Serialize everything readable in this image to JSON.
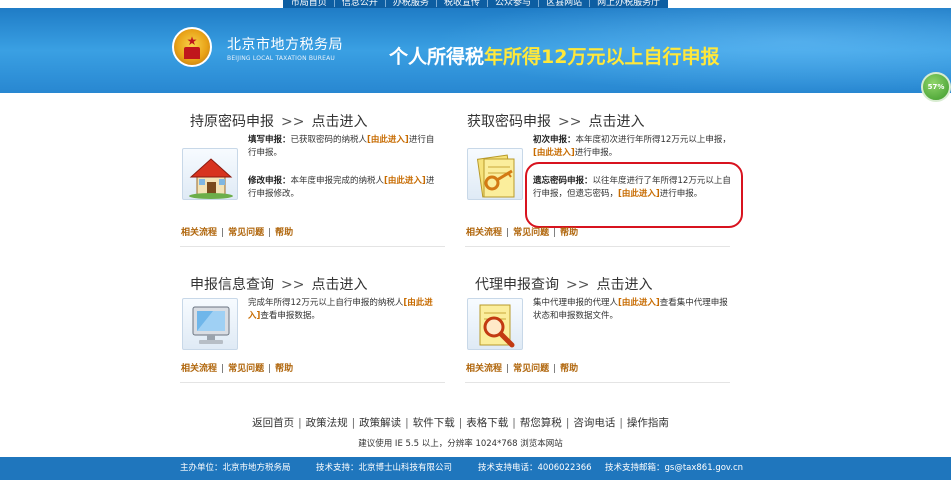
{
  "top_nav": [
    "市局首页",
    "信息公开",
    "办税服务",
    "税收宣传",
    "公众参与",
    "区县网站",
    "网上办税服务厅"
  ],
  "header": {
    "org_cn": "北京市地方税务局",
    "org_en": "BEIJING LOCAL TAXATION BUREAU",
    "title_prefix": "个人所得税",
    "title_highlight": "年所得12万元以上自行申报"
  },
  "progress_badge": "57%",
  "sections": {
    "original_password": {
      "title": "持原密码申报",
      "arrows": ">>",
      "enter": "点击进入",
      "fill_label": "填写申报：",
      "fill_text_1": "已获取密码的纳税人",
      "fill_link": "[由此进入]",
      "fill_text_2": "进行自行申报。",
      "modify_label": "修改申报：",
      "modify_text_1": "本年度申报完成的纳税人",
      "modify_link": "[由此进入]",
      "modify_text_2": "进行申报修改。",
      "links": [
        "相关流程",
        "常见问题",
        "帮助"
      ]
    },
    "get_password": {
      "title": "获取密码申报",
      "arrows": ">>",
      "enter": "点击进入",
      "first_label": "初次申报：",
      "first_text_1": "本年度初次进行年所得12万元以上申报，",
      "first_link": "[由此进入]",
      "first_text_2": "进行申报。",
      "forgot_label": "遗忘密码申报：",
      "forgot_text_1": "以往年度进行了年所得12万元以上自行申报，但遗忘密码，",
      "forgot_link": "[由此进入]",
      "forgot_text_2": "进行申报。",
      "links": [
        "相关流程",
        "常见问题",
        "帮助"
      ]
    },
    "query": {
      "title": "申报信息查询",
      "arrows": ">>",
      "enter": "点击进入",
      "text_1": "完成年所得12万元以上自行申报的纳税人",
      "link": "[由此进入]",
      "text_2": "查看申报数据。",
      "links": [
        "相关流程",
        "常见问题",
        "帮助"
      ]
    },
    "agent_query": {
      "title": "代理申报查询",
      "arrows": ">>",
      "enter": "点击进入",
      "text_1": "集中代理申报的代理人",
      "link": "[由此进入]",
      "text_2": "查看集中代理申报状态和申报数据文件。",
      "links": [
        "相关流程",
        "常见问题",
        "帮助"
      ]
    }
  },
  "footer_links": [
    "返回首页",
    "政策法规",
    "政策解读",
    "软件下载",
    "表格下载",
    "帮您算税",
    "咨询电话",
    "操作指南"
  ],
  "footer_note": "建议使用 IE 5.5 以上，分辨率 1024*768 浏览本网站",
  "footer_bar": {
    "host": "主办单位：北京市地方税务局",
    "tech": "技术支持：北京博士山科技有限公司",
    "phone": "技术支持电话：4006022366",
    "email": "技术支持邮箱：gs@tax861.gov.cn"
  },
  "colors": {
    "header_blue": "#2887d1",
    "title_highlight": "#ffe83a",
    "link_orange": "#b0660c",
    "highlight_red": "#d8131f",
    "footer_blue": "#1f76bd"
  }
}
